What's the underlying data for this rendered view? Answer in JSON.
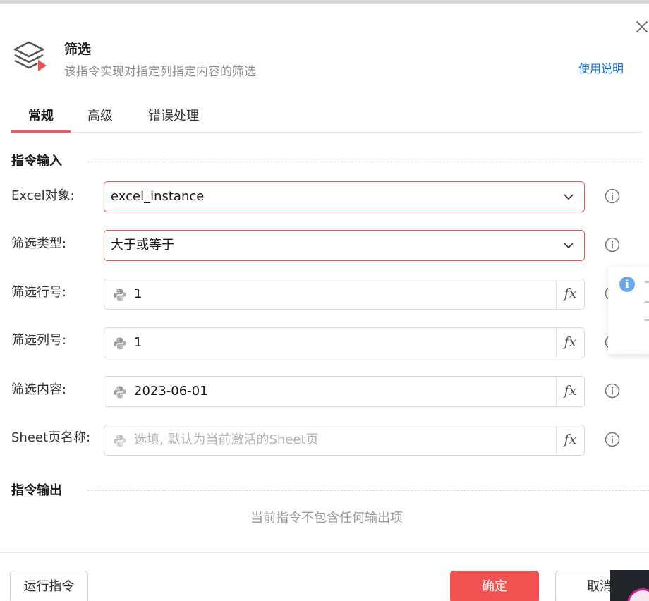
{
  "dialog": {
    "title": "筛选",
    "subtitle": "该指令实现对指定列指定内容的筛选",
    "help_link": "使用说明"
  },
  "tabs": [
    {
      "label": "常规",
      "active": true
    },
    {
      "label": "高级",
      "active": false
    },
    {
      "label": "错误处理",
      "active": false
    }
  ],
  "input_section": {
    "title": "指令输入",
    "fields": {
      "excel_object": {
        "label": "Excel对象:",
        "value": "excel_instance"
      },
      "filter_type": {
        "label": "筛选类型:",
        "value": "大于或等于"
      },
      "filter_row": {
        "label": "筛选行号:",
        "value": "1"
      },
      "filter_col": {
        "label": "筛选列号:",
        "value": "1"
      },
      "filter_content": {
        "label": "筛选内容:",
        "value": "2023-06-01"
      },
      "sheet_name": {
        "label": "Sheet页名称:",
        "value": "",
        "placeholder": "选填, 默认为当前激活的Sheet页"
      }
    },
    "fx_label": "fx"
  },
  "output_section": {
    "title": "指令输出",
    "empty_text": "当前指令不包含任何输出项"
  },
  "footer": {
    "run_label": "运行指令",
    "ok_label": "确定",
    "cancel_label": "取消"
  },
  "colors": {
    "accent": "#f05252",
    "link": "#1677d9",
    "info_tip": "#6aa8ec"
  },
  "icons": [
    "close-icon",
    "layers-icon",
    "chevron-down-icon",
    "python-icon",
    "info-icon"
  ]
}
